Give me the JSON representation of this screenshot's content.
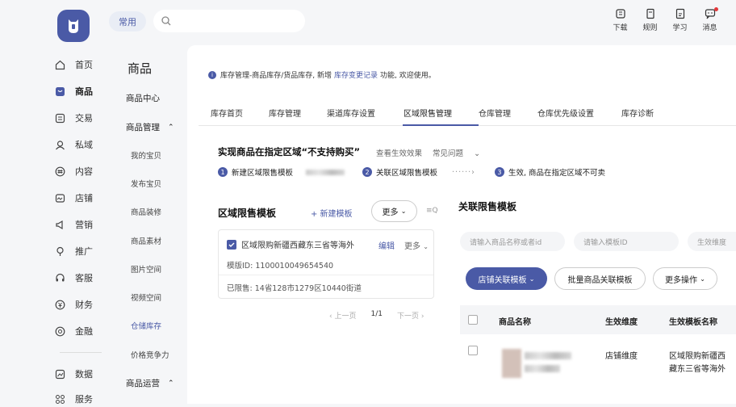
{
  "topbar": {
    "common_tag": "常用",
    "search_placeholder": "",
    "actions": [
      {
        "label": "下载",
        "icon": "download-icon"
      },
      {
        "label": "规则",
        "icon": "rules-icon"
      },
      {
        "label": "学习",
        "icon": "learn-icon"
      },
      {
        "label": "消息",
        "icon": "message-icon"
      }
    ]
  },
  "sidebar": {
    "items": [
      {
        "label": "首页",
        "icon": "home-icon"
      },
      {
        "label": "商品",
        "icon": "goods-icon"
      },
      {
        "label": "交易",
        "icon": "trade-icon"
      },
      {
        "label": "私域",
        "icon": "private-domain-icon"
      },
      {
        "label": "内容",
        "icon": "content-icon"
      },
      {
        "label": "店铺",
        "icon": "store-icon"
      },
      {
        "label": "营销",
        "icon": "marketing-icon"
      },
      {
        "label": "推广",
        "icon": "promotion-icon"
      },
      {
        "label": "客服",
        "icon": "service-icon"
      },
      {
        "label": "财务",
        "icon": "finance-icon"
      },
      {
        "label": "金融",
        "icon": "banking-icon"
      },
      {
        "label": "数据",
        "icon": "data-icon"
      },
      {
        "label": "服务",
        "icon": "services-icon"
      }
    ]
  },
  "subnav": {
    "title": "商品",
    "center": "商品中心",
    "manage_head": "商品管理",
    "items": [
      "我的宝贝",
      "发布宝贝",
      "商品装修",
      "商品素材",
      "图片空间",
      "视频空间",
      "仓储库存",
      "价格竞争力"
    ],
    "ops_head": "商品运营"
  },
  "notice": {
    "prefix": "库存管理-商品库存/货品库存, 新增",
    "link": "库存变更记录",
    "suffix": "功能, 欢迎使用。"
  },
  "tabs": [
    "库存首页",
    "库存管理",
    "渠道库存设置",
    "区域限售管理",
    "仓库管理",
    "仓库优先级设置",
    "库存诊断"
  ],
  "header": {
    "title": "实现商品在指定区域“不支持购买”",
    "view_effect": "查看生效效果",
    "faq": "常见问题"
  },
  "steps": {
    "s1_num": "1",
    "s1": "新建区域限售模板",
    "s2_num": "2",
    "s2": "关联区域限售模板",
    "s3_num": "3",
    "s3": "生效, 商品在指定区域不可卖"
  },
  "left_panel": {
    "title": "区域限售模板",
    "new_btn": "+ 新建模板",
    "more_btn": "更多",
    "card": {
      "name": "区域限购新疆西藏东三省等海外",
      "edit": "编辑",
      "more": "更多",
      "template_id": "模版ID: 1100010049654540",
      "limited": "已限售: 14省128市1279区10440街道"
    },
    "pager": {
      "prev": "上一页",
      "page": "1/1",
      "next": "下一页"
    }
  },
  "right_panel": {
    "title": "关联限售模板",
    "filter_name_placeholder": "请输入商品名称或者id",
    "filter_tpl_placeholder": "请输入模板ID",
    "filter_dim_placeholder": "生效维度",
    "btn_link": "店铺关联模板",
    "btn_batch": "批量商品关联模板",
    "btn_more_ops": "更多操作",
    "table": {
      "col_name": "商品名称",
      "col_dim": "生效维度",
      "col_tpl": "生效模板名称",
      "rows": [
        {
          "dim": "店铺维度",
          "tpl_line1": "区域限购新疆西",
          "tpl_line2": "藏东三省等海外"
        }
      ]
    }
  },
  "colors": {
    "accent": "#4a5aa6",
    "bg": "#f5f6f8"
  }
}
